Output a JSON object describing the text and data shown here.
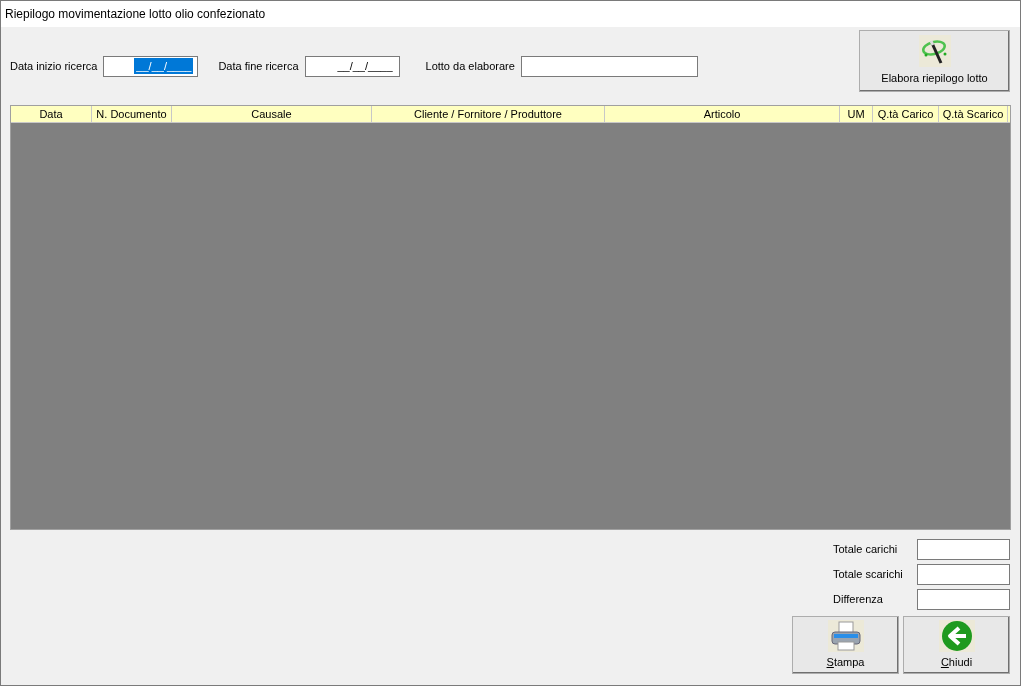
{
  "window": {
    "title": "Riepilogo movimentazione lotto olio confezionato"
  },
  "filters": [
    {
      "label": "Data inizio ricerca",
      "value": "__/__/____",
      "selected": true
    },
    {
      "label": "Data fine ricerca",
      "value": "__/__/____",
      "selected": false
    }
  ],
  "lot_field": {
    "label": "Lotto da elaborare"
  },
  "process_button": {
    "label": "Elabora riepilogo lotto"
  },
  "table": {
    "columns": [
      "Data",
      "N. Documento",
      "Causale",
      "Cliente / Fornitore / Produttore",
      "Articolo",
      "UM",
      "Q.tà Carico",
      "Q.tà Scarico"
    ]
  },
  "totals": [
    {
      "label": "Totale carichi"
    },
    {
      "label": "Totale scarichi"
    },
    {
      "label": "Differenza"
    }
  ],
  "buttons": [
    {
      "kind": "print",
      "mnemonic": "S",
      "rest": "tampa"
    },
    {
      "kind": "close",
      "mnemonic": "C",
      "rest": "hiudi"
    }
  ]
}
